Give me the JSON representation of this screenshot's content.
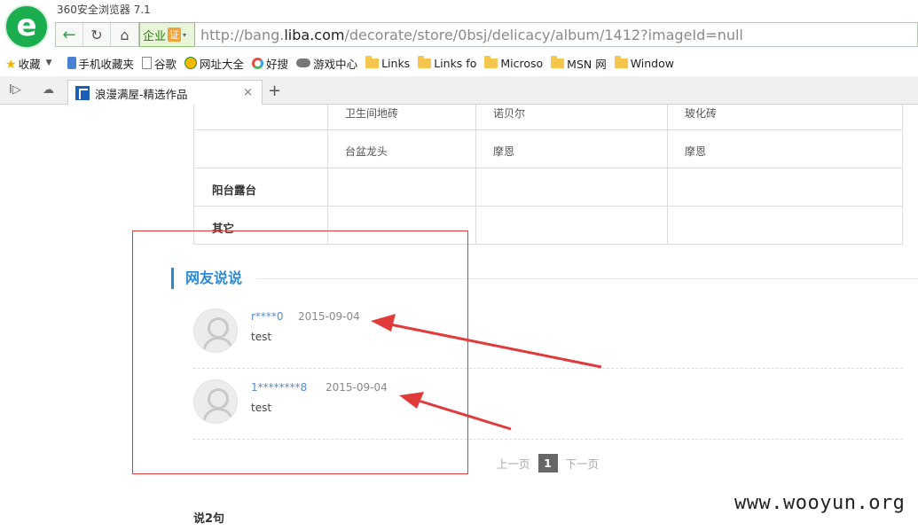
{
  "browser": {
    "title": "360安全浏览器 7.1",
    "ev_label": "企业",
    "ev_cert": "证",
    "url_prefix": "http://bang.",
    "url_domain": "liba.com",
    "url_path": "/decorate/store/0bsj/delicacy/album/1412?imageId=null"
  },
  "bookmarks": [
    {
      "label": "收藏",
      "icon": "star-icon"
    },
    {
      "label": "手机收藏夹",
      "icon": "phone-icon"
    },
    {
      "label": "谷歌",
      "icon": "document-icon"
    },
    {
      "label": "网址大全",
      "icon": "globe-icon"
    },
    {
      "label": "好搜",
      "icon": "search-engine-icon"
    },
    {
      "label": "游戏中心",
      "icon": "gamepad-icon"
    },
    {
      "label": "Links",
      "icon": "folder-icon"
    },
    {
      "label": "Links fo",
      "icon": "folder-icon"
    },
    {
      "label": "Microso",
      "icon": "folder-icon"
    },
    {
      "label": "MSN 网",
      "icon": "folder-icon"
    },
    {
      "label": "Window",
      "icon": "folder-icon"
    }
  ],
  "tab": {
    "title": "浪漫满屋-精选作品",
    "close": "×",
    "new": "+"
  },
  "spec_table": {
    "rows": [
      {
        "head": "",
        "cells": [
          "卫生间地砖",
          "诺贝尔",
          "玻化砖"
        ]
      },
      {
        "head": "",
        "cells": [
          "台盆龙头",
          "摩恩",
          "摩恩"
        ]
      },
      {
        "head": "阳台露台",
        "cells": [
          "",
          "",
          ""
        ]
      },
      {
        "head": "其它",
        "cells": [
          "",
          "",
          ""
        ]
      }
    ]
  },
  "comments_section": {
    "title": "网友说说",
    "comments": [
      {
        "user": "r****0",
        "date": "2015-09-04",
        "text": "test"
      },
      {
        "user": "1********8",
        "date": "2015-09-04",
        "text": "test"
      }
    ]
  },
  "pager": {
    "prev": "上一页",
    "current": "1",
    "next": "下一页"
  },
  "next_section": {
    "title": "说2句"
  },
  "watermark": "www.wooyun.org",
  "colors": {
    "accent": "#2b8ad8",
    "annotation": "#e03a3a",
    "username": "#5a8ac8"
  }
}
